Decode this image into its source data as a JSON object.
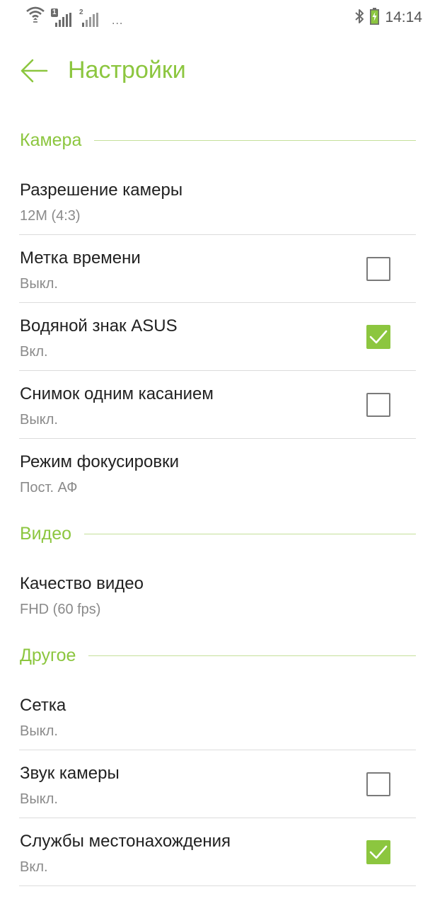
{
  "status_bar": {
    "time": "14:14",
    "sim1_badge": "1",
    "sim2_badge": "2",
    "more_indicator": "..."
  },
  "header": {
    "title": "Настройки"
  },
  "sections": {
    "camera": {
      "title": "Камера",
      "items": [
        {
          "label": "Разрешение камеры",
          "value": "12M (4:3)"
        },
        {
          "label": "Метка времени",
          "value": "Выкл.",
          "checked": false
        },
        {
          "label": "Водяной знак ASUS",
          "value": "Вкл.",
          "checked": true
        },
        {
          "label": "Снимок одним касанием",
          "value": "Выкл.",
          "checked": false
        },
        {
          "label": "Режим фокусировки",
          "value": "Пост. АФ"
        }
      ]
    },
    "video": {
      "title": "Видео",
      "items": [
        {
          "label": "Качество видео",
          "value": "FHD (60 fps)"
        }
      ]
    },
    "other": {
      "title": "Другое",
      "items": [
        {
          "label": "Сетка",
          "value": "Выкл."
        },
        {
          "label": "Звук камеры",
          "value": "Выкл.",
          "checked": false
        },
        {
          "label": "Службы местонахождения",
          "value": "Вкл.",
          "checked": true
        }
      ]
    }
  },
  "colors": {
    "accent": "#8cc63f",
    "divider": "#dcdcdc",
    "secondary_text": "#8a8a8a"
  }
}
